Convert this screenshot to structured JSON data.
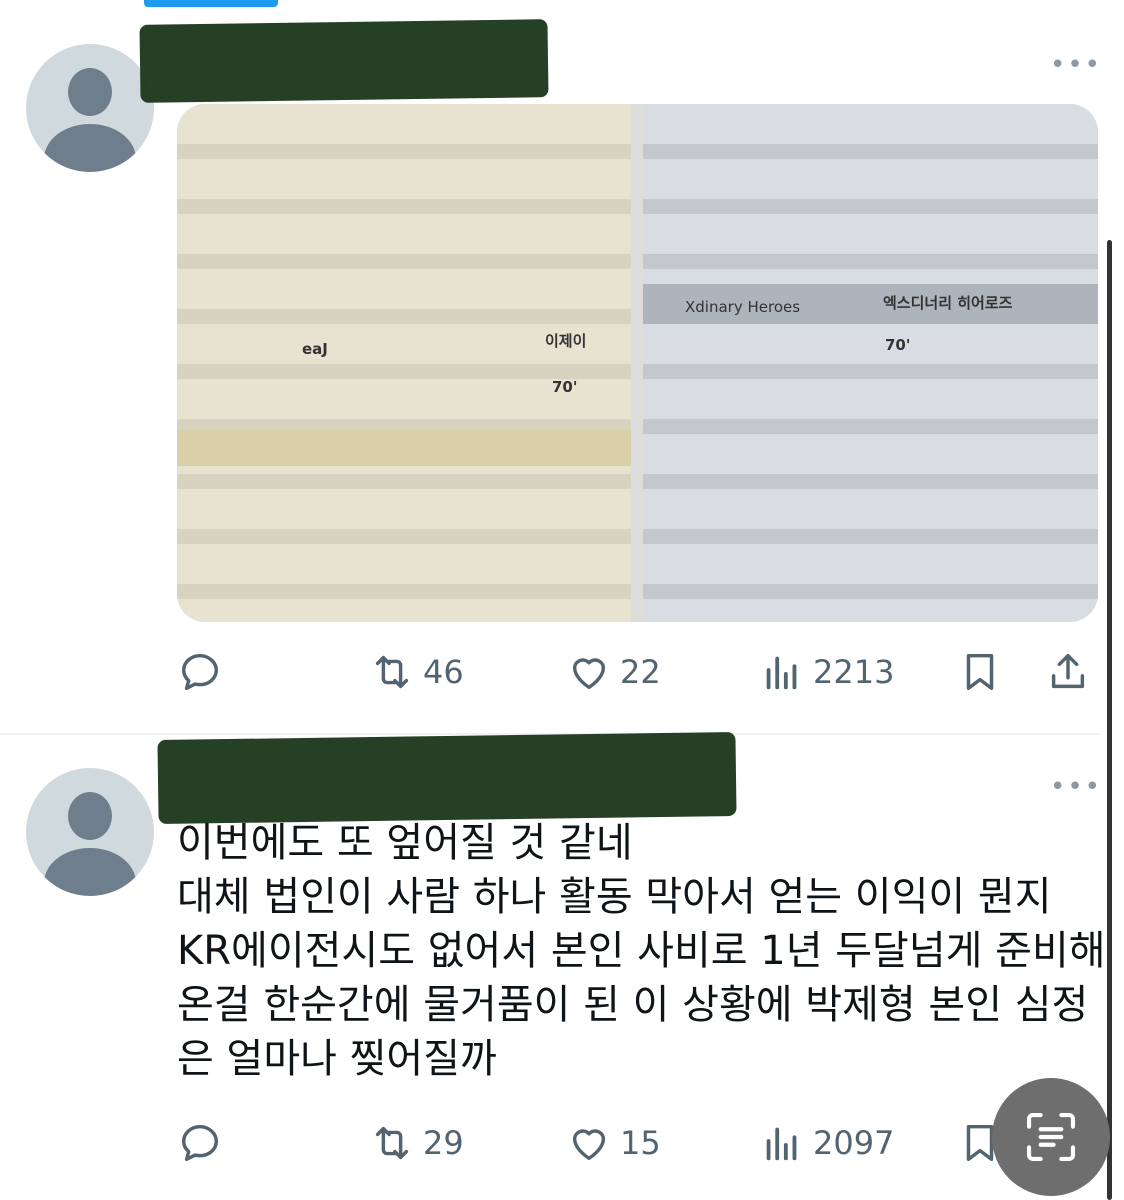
{
  "tweet1": {
    "more_label": "•••",
    "media": {
      "left": {
        "row_label": "eaJ",
        "row_value": "이제이",
        "row_number": "70'"
      },
      "right": {
        "row_label": "Xdinary Heroes",
        "row_value": "엑스디너리 히어로즈",
        "row_number": "70'"
      }
    },
    "actions": {
      "retweets": "46",
      "likes": "22",
      "views": "2213"
    }
  },
  "tweet2": {
    "more_label": "•••",
    "text_lines": [
      "이번에도 또 엎어질 것 같네",
      "대체 법인이 사람 하나 활동 막아서 얻는 이익이 뭔지",
      "KR에이전시도 없어서 본인 사비로 1년 두달넘게 준비해",
      "온걸 한순간에 물거품이 된 이 상황에 박제형 본인 심정",
      "은 얼마나 찢어질까"
    ],
    "actions": {
      "retweets": "29",
      "likes": "15",
      "views": "2097"
    }
  },
  "colors": {
    "accent": "#1d9bf0",
    "icon_gray": "#536471",
    "redaction": "#1f3a1f"
  },
  "icons": [
    "reply-icon",
    "retweet-icon",
    "like-icon",
    "views-icon",
    "bookmark-icon",
    "share-icon",
    "text-scan-icon"
  ]
}
